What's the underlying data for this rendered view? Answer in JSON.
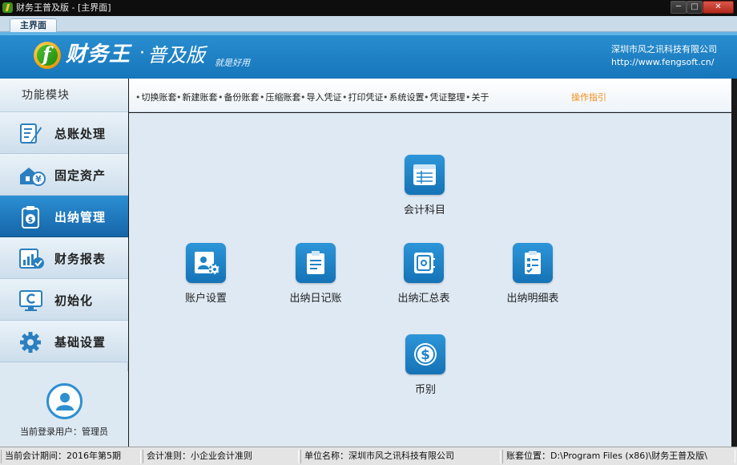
{
  "window": {
    "title": "财务王普及版 - [主界面]",
    "tab": "主界面"
  },
  "banner": {
    "brand": "财务王",
    "dot": "·",
    "edition": "普及版",
    "slogan": "就是好用",
    "company": "深圳市风之讯科技有限公司",
    "url": "http://www.fengsoft.cn/"
  },
  "sidebar": {
    "heading": "功能模块",
    "items": [
      {
        "label": "总账处理",
        "icon": "ledger-pen-icon",
        "active": false
      },
      {
        "label": "固定资产",
        "icon": "house-yen-icon",
        "active": false
      },
      {
        "label": "出纳管理",
        "icon": "cash-clipboard-icon",
        "active": true
      },
      {
        "label": "财务报表",
        "icon": "report-check-icon",
        "active": false
      },
      {
        "label": "初始化",
        "icon": "monitor-reset-icon",
        "active": false
      },
      {
        "label": "基础设置",
        "icon": "gear-icon",
        "active": false
      }
    ],
    "user_label": "当前登录用户：管理员"
  },
  "toolbar": {
    "items": [
      "切换账套",
      "新建账套",
      "备份账套",
      "压缩账套",
      "导入凭证",
      "打印凭证",
      "系统设置",
      "凭证整理",
      "关于"
    ],
    "guide": "操作指引"
  },
  "modules": [
    {
      "label": "会计科目",
      "icon": "chart-of-accounts-icon"
    },
    {
      "label": "账户设置",
      "icon": "account-settings-icon"
    },
    {
      "label": "出纳日记账",
      "icon": "cash-journal-icon"
    },
    {
      "label": "出纳汇总表",
      "icon": "cash-summary-icon"
    },
    {
      "label": "出纳明细表",
      "icon": "cash-detail-icon"
    },
    {
      "label": "币别",
      "icon": "currency-icon"
    }
  ],
  "status": {
    "period": "当前会计期间：2016年第5期",
    "standard": "会计准则：小企业会计准则",
    "unit": "单位名称：深圳市风之讯科技有限公司",
    "location": "账套位置：D:\\Program Files (x86)\\财务王普及版\\"
  },
  "colors": {
    "accent": "#1d7fc4",
    "active_item": "#1565a8",
    "guide": "#f08c1a"
  }
}
